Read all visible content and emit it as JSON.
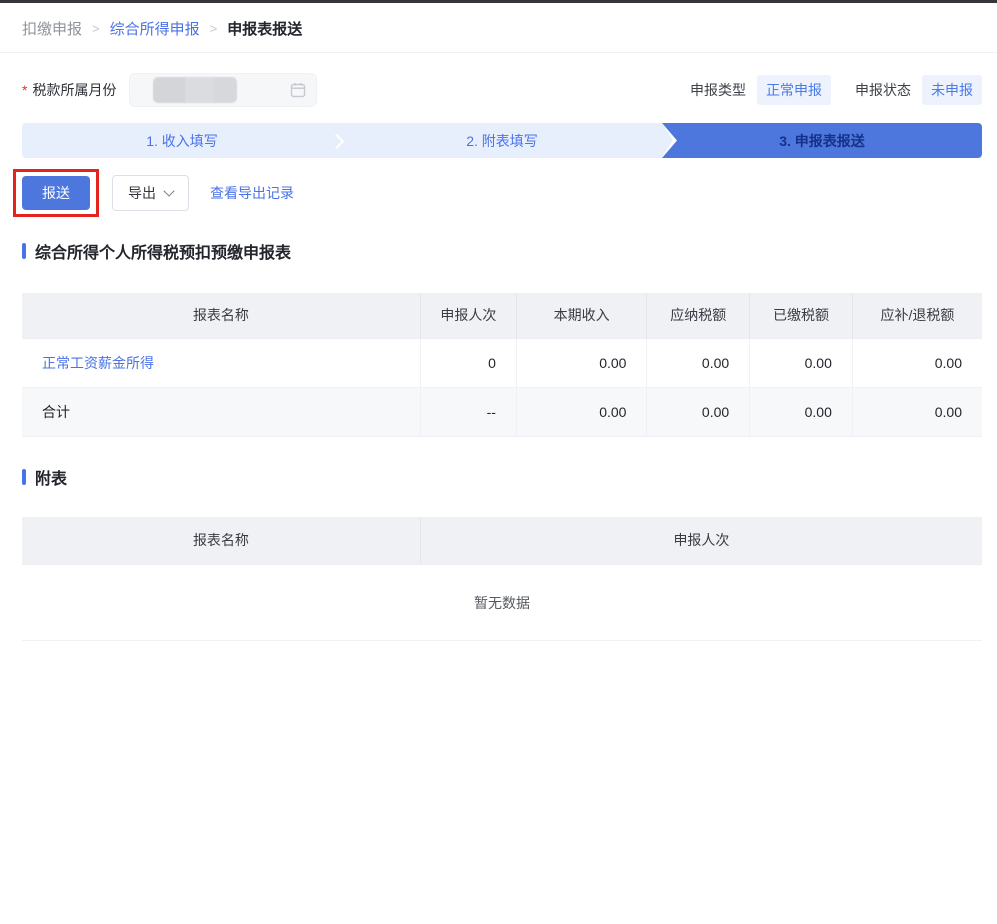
{
  "breadcrumb": {
    "separator": ">",
    "items": [
      {
        "label": "扣缴申报"
      },
      {
        "label": "综合所得申报"
      },
      {
        "label": "申报表报送"
      }
    ]
  },
  "filter": {
    "required_mark": "*",
    "month_label": "税款所属月份",
    "month_value": "",
    "declare_type_label": "申报类型",
    "declare_type_value": "正常申报",
    "declare_status_label": "申报状态",
    "declare_status_value": "未申报"
  },
  "steps": [
    {
      "label": "1. 收入填写",
      "active": false
    },
    {
      "label": "2. 附表填写",
      "active": false
    },
    {
      "label": "3. 申报表报送",
      "active": true
    }
  ],
  "toolbar": {
    "submit_label": "报送",
    "export_label": "导出",
    "view_export_records_label": "查看导出记录"
  },
  "main_table": {
    "title": "综合所得个人所得税预扣预缴申报表",
    "columns": [
      "报表名称",
      "申报人次",
      "本期收入",
      "应纳税额",
      "已缴税额",
      "应补/退税额"
    ],
    "rows": [
      {
        "name": "正常工资薪金所得",
        "is_link": true,
        "values": [
          "0",
          "0.00",
          "0.00",
          "0.00",
          "0.00"
        ]
      },
      {
        "name": "合计",
        "is_link": false,
        "values": [
          "--",
          "0.00",
          "0.00",
          "0.00",
          "0.00"
        ]
      }
    ]
  },
  "sub_table": {
    "title": "附表",
    "columns": [
      "报表名称",
      "申报人次"
    ],
    "empty_text": "暂无数据"
  },
  "icons": {
    "month_field": "calendar-icon",
    "export_button": "chevron-down-icon"
  },
  "colors": {
    "accent_blue": "#4a73e8",
    "accent_fill": "#4d77dc",
    "step_inactive_bg": "#e7effc",
    "badge_bg": "#edf2fd",
    "annotation_red": "#e42320",
    "table_header_bg": "#f0f1f4",
    "stripe_row_bg": "#f7f8fa"
  }
}
